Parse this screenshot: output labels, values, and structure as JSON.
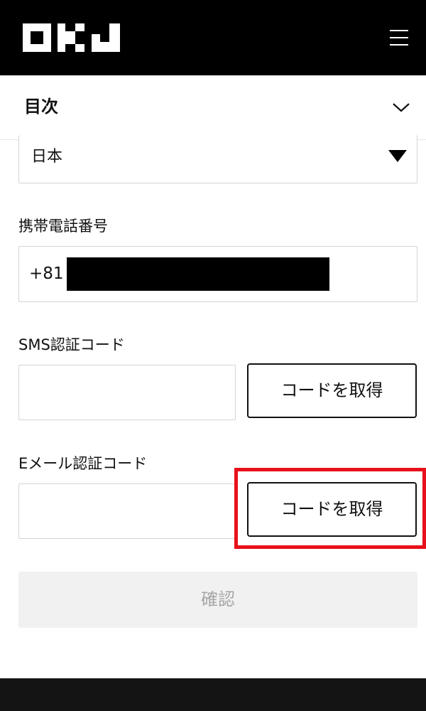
{
  "header": {
    "logo_text": "OKJ",
    "menu_icon": "hamburger-menu-icon",
    "background": "#000000"
  },
  "toc": {
    "title": "目次",
    "toggle_icon": "chevron-down-icon"
  },
  "form": {
    "country": {
      "value": "日本",
      "icon": "caret-down-icon"
    },
    "phone": {
      "label": "携帯電話番号",
      "prefix": "+81"
    },
    "sms": {
      "label": "SMS認証コード",
      "value": "",
      "button_label": "コードを取得"
    },
    "email": {
      "label": "Eメール認証コード",
      "value": "",
      "button_label": "コードを取得"
    },
    "confirm_label": "確認"
  },
  "colors": {
    "highlight": "#e8101a",
    "disabled_bg": "#f1f1f1",
    "disabled_text": "#a6a6a6"
  }
}
